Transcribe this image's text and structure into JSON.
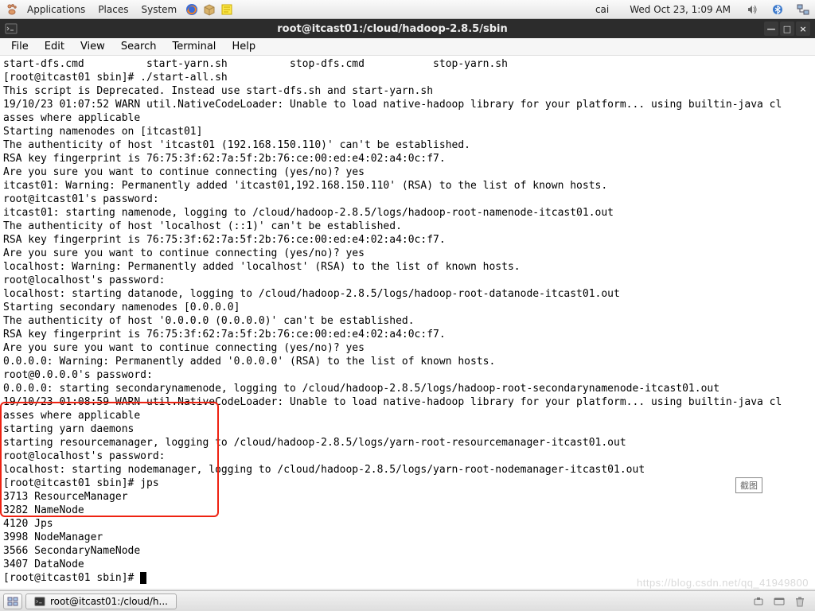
{
  "panel": {
    "apps": "Applications",
    "places": "Places",
    "system": "System",
    "user": "cai",
    "clock": "Wed Oct 23,  1:09 AM"
  },
  "window": {
    "title": "root@itcast01:/cloud/hadoop-2.8.5/sbin"
  },
  "menubar": {
    "file": "File",
    "edit": "Edit",
    "view": "View",
    "search": "Search",
    "terminal": "Terminal",
    "help": "Help"
  },
  "terminal": {
    "lines": [
      "start-dfs.cmd          start-yarn.sh          stop-dfs.cmd           stop-yarn.sh",
      "[root@itcast01 sbin]# ./start-all.sh",
      "This script is Deprecated. Instead use start-dfs.sh and start-yarn.sh",
      "19/10/23 01:07:52 WARN util.NativeCodeLoader: Unable to load native-hadoop library for your platform... using builtin-java cl",
      "asses where applicable",
      "Starting namenodes on [itcast01]",
      "The authenticity of host 'itcast01 (192.168.150.110)' can't be established.",
      "RSA key fingerprint is 76:75:3f:62:7a:5f:2b:76:ce:00:ed:e4:02:a4:0c:f7.",
      "Are you sure you want to continue connecting (yes/no)? yes",
      "itcast01: Warning: Permanently added 'itcast01,192.168.150.110' (RSA) to the list of known hosts.",
      "root@itcast01's password:",
      "itcast01: starting namenode, logging to /cloud/hadoop-2.8.5/logs/hadoop-root-namenode-itcast01.out",
      "The authenticity of host 'localhost (::1)' can't be established.",
      "RSA key fingerprint is 76:75:3f:62:7a:5f:2b:76:ce:00:ed:e4:02:a4:0c:f7.",
      "Are you sure you want to continue connecting (yes/no)? yes",
      "localhost: Warning: Permanently added 'localhost' (RSA) to the list of known hosts.",
      "root@localhost's password:",
      "localhost: starting datanode, logging to /cloud/hadoop-2.8.5/logs/hadoop-root-datanode-itcast01.out",
      "Starting secondary namenodes [0.0.0.0]",
      "The authenticity of host '0.0.0.0 (0.0.0.0)' can't be established.",
      "RSA key fingerprint is 76:75:3f:62:7a:5f:2b:76:ce:00:ed:e4:02:a4:0c:f7.",
      "Are you sure you want to continue connecting (yes/no)? yes",
      "0.0.0.0: Warning: Permanently added '0.0.0.0' (RSA) to the list of known hosts.",
      "root@0.0.0.0's password:",
      "0.0.0.0: starting secondarynamenode, logging to /cloud/hadoop-2.8.5/logs/hadoop-root-secondarynamenode-itcast01.out",
      "19/10/23 01:08:59 WARN util.NativeCodeLoader: Unable to load native-hadoop library for your platform... using builtin-java cl",
      "asses where applicable",
      "starting yarn daemons",
      "starting resourcemanager, logging to /cloud/hadoop-2.8.5/logs/yarn-root-resourcemanager-itcast01.out",
      "root@localhost's password:",
      "localhost: starting nodemanager, logging to /cloud/hadoop-2.8.5/logs/yarn-root-nodemanager-itcast01.out",
      "[root@itcast01 sbin]# jps",
      "3713 ResourceManager",
      "3282 NameNode",
      "4120 Jps",
      "3998 NodeManager",
      "3566 SecondaryNameNode",
      "3407 DataNode",
      "[root@itcast01 sbin]# "
    ]
  },
  "taskbar": {
    "task_label": "root@itcast01:/cloud/h..."
  },
  "screenshot_label": "截图",
  "watermark": "https://blog.csdn.net/qq_41949800"
}
